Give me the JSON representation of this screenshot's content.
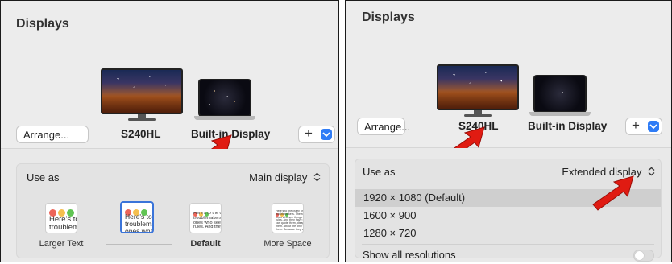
{
  "colors": {
    "accent": "#2f7cf6",
    "arrow": "#e01b12",
    "selection": "#3a74d9"
  },
  "left": {
    "title": "Displays",
    "arrange_label": "Arrange...",
    "displays": [
      {
        "name": "S240HL"
      },
      {
        "name": "Built-in Display"
      }
    ],
    "use_as_label": "Use as",
    "use_as_value": "Main display",
    "thumbnails": [
      {
        "label": "Larger Text",
        "bold": false,
        "selected": false,
        "text": "Here's to\ntroublem"
      },
      {
        "label": "",
        "bold": false,
        "selected": true,
        "text": "Here's to t\ntroublema\nones who"
      },
      {
        "label": "Default",
        "bold": true,
        "selected": false,
        "text": "Here's to the cr\ntroublemakers.\nones who see t\nrules. And they"
      },
      {
        "label": "More Space",
        "bold": false,
        "selected": false,
        "text": "Here's to the crazy one\ntroublemakers. The rou\nones who see things dif\nrules. And they have no\ncan quote them, disagr\nthem. About the only th\nthem. Because they cha"
      }
    ],
    "plus_icon": "plus-icon",
    "chevron_icon": "chevron-down-icon"
  },
  "right": {
    "title": "Displays",
    "arrange_label": "Arrange...",
    "displays": [
      {
        "name": "S240HL"
      },
      {
        "name": "Built-in Display"
      }
    ],
    "use_as_label": "Use as",
    "use_as_value": "Extended display",
    "resolutions": [
      "1920 × 1080 (Default)",
      "1600 × 900",
      "1280 × 720"
    ],
    "selected_resolution": "1920 × 1080 (Default)",
    "show_all_label": "Show all resolutions",
    "show_all_on": false
  }
}
